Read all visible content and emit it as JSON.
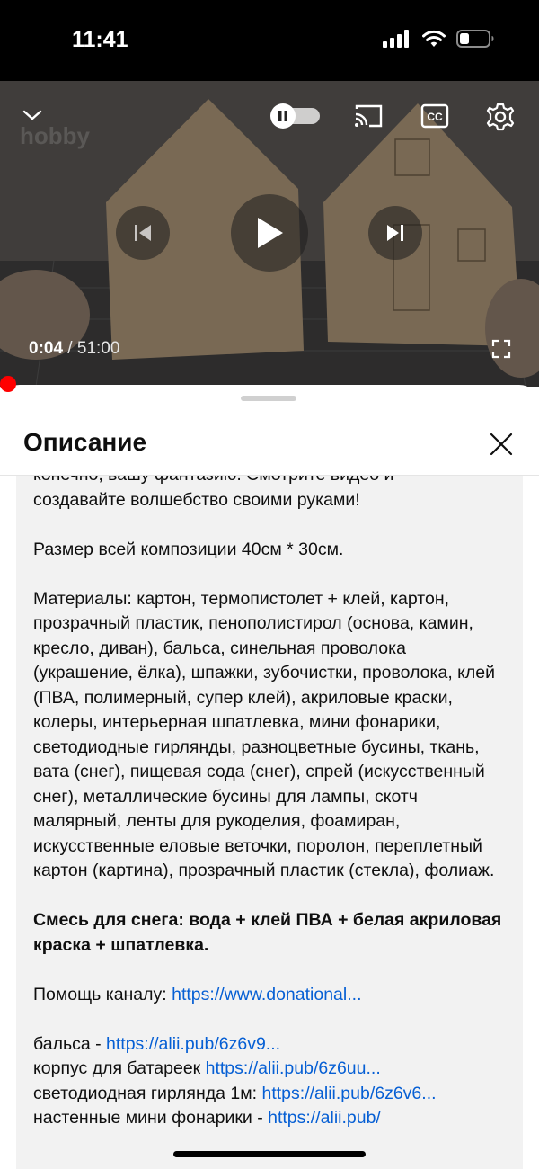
{
  "status_bar": {
    "time": "11:41",
    "icons": [
      "signal-icon",
      "wifi-icon",
      "battery-icon"
    ]
  },
  "video": {
    "watermark": "hobby",
    "time_current": "0:04",
    "time_separator": " / ",
    "time_total": "51:00",
    "progress_fraction": 0.0013,
    "autoplay_state": "on",
    "controls": [
      "chevron-down-icon",
      "autoplay-toggle",
      "cast-icon",
      "cc-icon",
      "gear-icon",
      "previous-icon",
      "play-icon",
      "next-icon",
      "fullscreen-icon"
    ],
    "colors": {
      "progress": "#ff0000"
    }
  },
  "sheet": {
    "title": "Описание",
    "close_icon": "close-icon",
    "partial_top_line": "конечно, вашу фантазию. Смотрите видео и",
    "paragraphs": {
      "p1": "создавайте волшебство своими руками!",
      "p2": "Размер всей композиции 40см * 30см.",
      "p3": "Материалы: картон, термопистолет + клей, картон, прозрачный пластик, пенополистирол (основа, камин, кресло, диван), бальса, синельная проволока (украшение, ёлка), шпажки, зубочистки, проволока, клей (ПВА, полимерный, супер клей), акриловые краски, колеры, интерьерная шпатлевка, мини фонарики, светодиодные гирлянды, разноцветные бусины, ткань, вата (снег), пищевая сода (снег), спрей (искусственный снег), металлические бусины для лампы, скотч малярный, ленты для рукоделия, фоамиран, искусственные еловые веточки, поролон, переплетный картон (картина), прозрачный пластик (стекла), фолиаж.",
      "p4": "Смесь для снега: вода + клей ПВА + белая акриловая краска + шпатлевка.",
      "help_label": "Помощь каналу: ",
      "help_link": "https://www.donational...",
      "link1_label": "бальса - ",
      "link1_url": "https://alii.pub/6z6v9...",
      "link2_label": "корпус для батареек ",
      "link2_url": "https://alii.pub/6z6uu...",
      "link3_label": "светодиодная гирлянда 1м: ",
      "link3_url": "https://alii.pub/6z6v6...",
      "link4_label": "настенные мини фонарики - ",
      "link4_url": "https://alii.pub/"
    },
    "colors": {
      "link": "#065fd4",
      "box": "#f2f2f2"
    }
  }
}
